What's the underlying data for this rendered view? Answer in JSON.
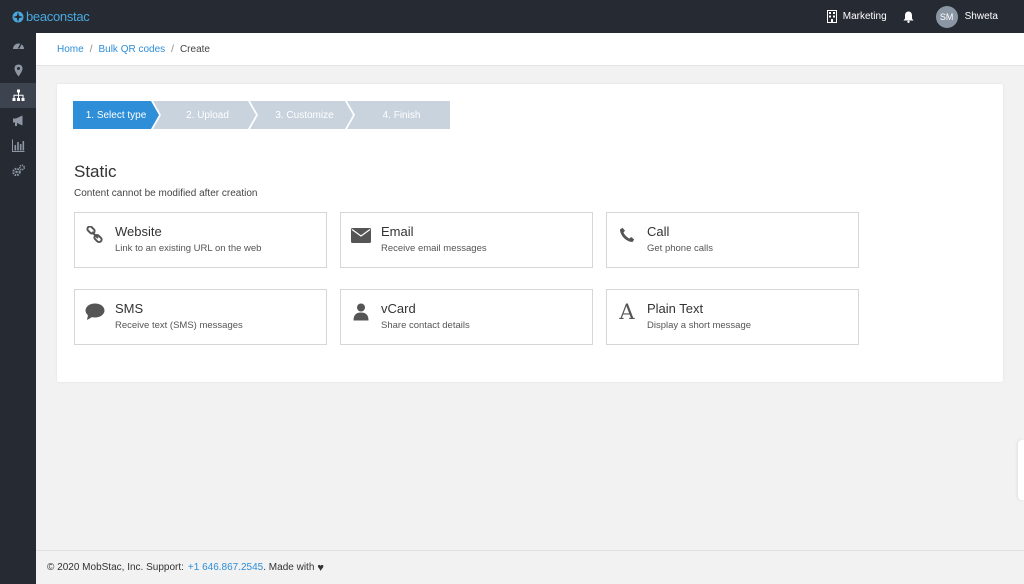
{
  "brand": {
    "name": "beaconstac",
    "logo_icon": "beaconstac-logo-icon",
    "color": "#4aa8e0"
  },
  "topbar": {
    "org_label": "Marketing",
    "org_icon": "building-icon",
    "notification_icon": "bell-icon",
    "user": {
      "initials": "SM",
      "name": "Shweta"
    }
  },
  "sidebar": {
    "items": [
      {
        "icon": "dashboard-icon",
        "active": false
      },
      {
        "icon": "location-pin-icon",
        "active": false
      },
      {
        "icon": "sitemap-icon",
        "active": true
      },
      {
        "icon": "megaphone-icon",
        "active": false
      },
      {
        "icon": "analytics-icon",
        "active": false
      },
      {
        "icon": "settings-icon",
        "active": false
      }
    ]
  },
  "breadcrumb": {
    "home": "Home",
    "bulk": "Bulk QR codes",
    "current": "Create",
    "separator": "/"
  },
  "steps": [
    {
      "label": "1. Select type",
      "active": true
    },
    {
      "label": "2. Upload",
      "active": false
    },
    {
      "label": "3. Customize",
      "active": false
    },
    {
      "label": "4. Finish",
      "active": false
    }
  ],
  "section": {
    "title": "Static",
    "subtitle": "Content cannot be modified after creation"
  },
  "cards": [
    {
      "title": "Website",
      "desc": "Link to an existing URL on the web",
      "icon": "link-icon"
    },
    {
      "title": "Email",
      "desc": "Receive email messages",
      "icon": "envelope-icon"
    },
    {
      "title": "Call",
      "desc": "Get phone calls",
      "icon": "phone-icon"
    },
    {
      "title": "SMS",
      "desc": "Receive text (SMS) messages",
      "icon": "chat-bubble-icon"
    },
    {
      "title": "vCard",
      "desc": "Share contact details",
      "icon": "user-icon"
    },
    {
      "title": "Plain Text",
      "desc": "Display a short message",
      "icon": "text-font-icon"
    }
  ],
  "footer": {
    "prefix": "© 2020 MobStac, Inc. Support:",
    "phone": "+1 646.867.2545",
    "suffix": ". Made with",
    "heart_icon": "heart-icon"
  },
  "colors": {
    "accent": "#2e8ed8",
    "topbar": "#262b33",
    "step_inactive": "#c8d3de"
  }
}
